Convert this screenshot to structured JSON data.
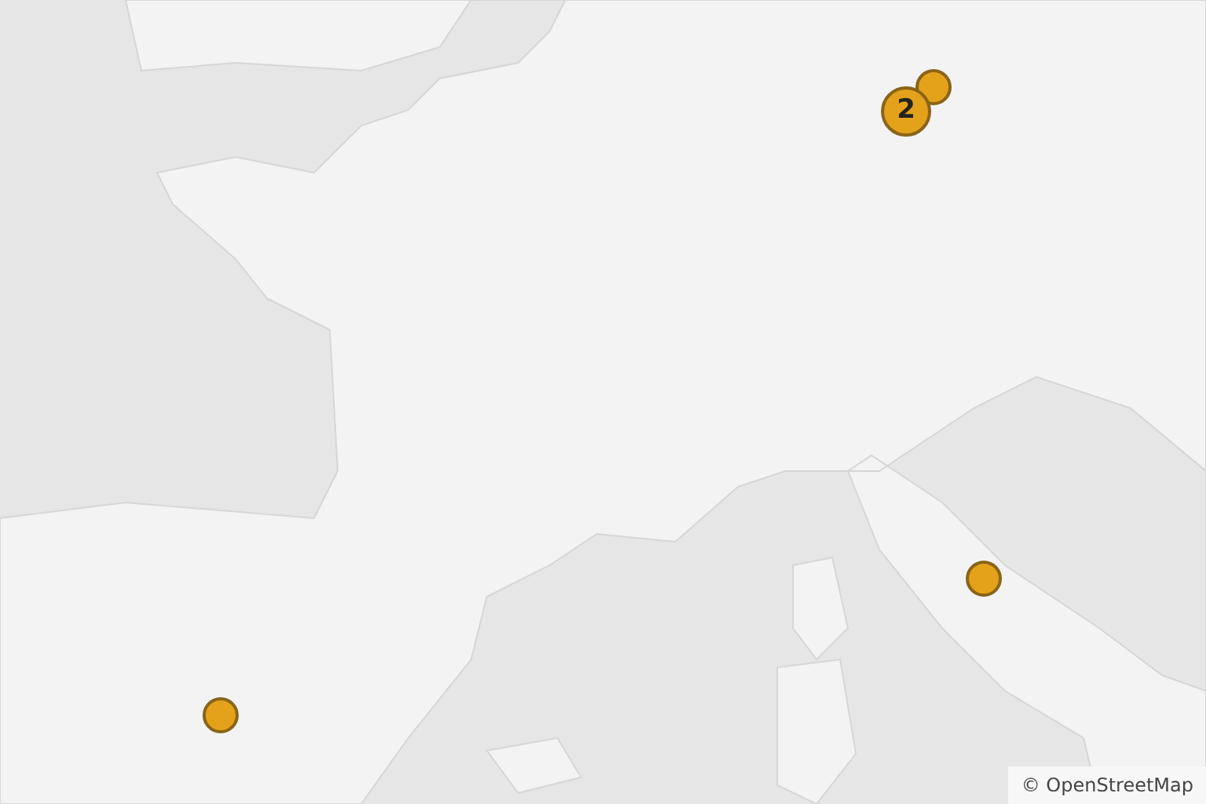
{
  "map": {
    "markers": [
      {
        "kind": "point"
      },
      {
        "kind": "cluster",
        "count": "2"
      },
      {
        "kind": "point"
      },
      {
        "kind": "point"
      }
    ],
    "attribution": "© OpenStreetMap"
  }
}
